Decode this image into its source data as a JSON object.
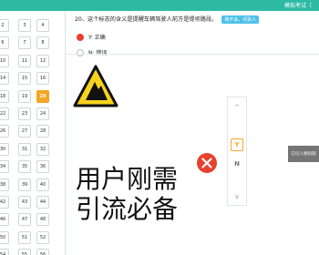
{
  "header": {
    "title": "模拟考试（"
  },
  "question_grid": {
    "numbers": [
      "2",
      "3",
      "4",
      "6",
      "7",
      "8",
      "10",
      "11",
      "12",
      "14",
      "15",
      "16",
      "18",
      "19",
      "20",
      "22",
      "23",
      "24",
      "26",
      "27",
      "28",
      "30",
      "31",
      "32",
      "34",
      "35",
      "36",
      "38",
      "39",
      "40",
      "42",
      "43",
      "44",
      "46",
      "47",
      "48",
      "50",
      "51",
      "52",
      "54",
      "55",
      "56"
    ],
    "current": "20"
  },
  "question": {
    "text": "20、这个标志的含义是提醒车辆驾驶人前方是堤坝路段。",
    "ask_button": "我不会，问别人"
  },
  "options": [
    {
      "label": "Y: 正确",
      "selected": true
    },
    {
      "label": "N: 错误",
      "selected": false
    }
  ],
  "overlay_text": [
    "用户刚需",
    "引流必备"
  ],
  "answer_selector": {
    "up": "^",
    "y": "Y",
    "n": "N",
    "down": "v"
  },
  "side_tab": "已切入模拟题"
}
